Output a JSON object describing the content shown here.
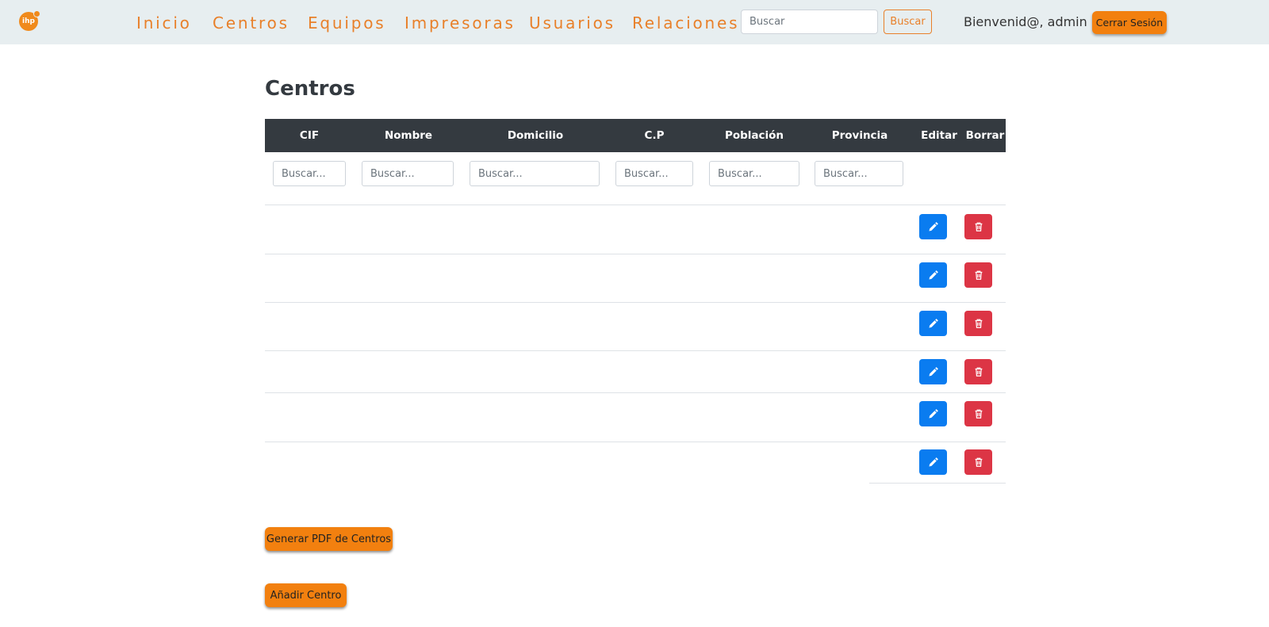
{
  "colors": {
    "accent": "#f2800f",
    "nav_text": "#e8802a",
    "table_header": "#343a40",
    "edit": "#0a7cf0",
    "delete": "#dc3545"
  },
  "navbar": {
    "logo": "ihp",
    "links": [
      "Inicio",
      "Centros",
      "Equipos",
      "Impresoras",
      "Usuarios",
      "Relaciones"
    ],
    "search_placeholder": "Buscar",
    "search_button": "Buscar",
    "welcome": "Bienvenid@, admin",
    "logout": "Cerrar Sesión"
  },
  "page": {
    "title": "Centros"
  },
  "table": {
    "columns": [
      "CIF",
      "Nombre",
      "Domicilio",
      "C.P",
      "Población",
      "Provincia",
      "Editar",
      "Borrar"
    ],
    "filter_placeholder": "Buscar...",
    "row_count": 6,
    "row_icons": {
      "edit": "pencil-icon",
      "delete": "trash-icon"
    }
  },
  "actions": {
    "pdf": "Generar PDF de Centros",
    "add": "Añadir Centro"
  }
}
